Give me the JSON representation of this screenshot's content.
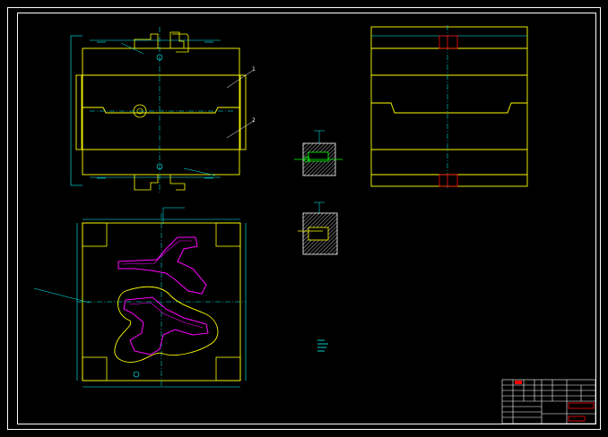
{
  "drawing": {
    "background": "#000000",
    "colors": {
      "border": "#ffffff",
      "outline": "#ffff00",
      "dimension": "#00ffff",
      "centerline": "#00ffff",
      "cavity": "#ff00ff",
      "section": "#00ff00",
      "hatch": "#ffffff",
      "highlight": "#ff0000"
    },
    "views": [
      {
        "name": "top-view",
        "kind": "plan"
      },
      {
        "name": "front-section-view",
        "kind": "section"
      },
      {
        "name": "plan-cavity-view",
        "kind": "cavity"
      },
      {
        "name": "detail-a",
        "kind": "detail"
      },
      {
        "name": "detail-b",
        "kind": "detail"
      }
    ],
    "balloons": [
      "1",
      "2"
    ]
  },
  "title_block": {
    "rows": [
      "",
      "",
      "",
      "",
      "",
      "",
      "",
      ""
    ],
    "stamp_color": "#ff0000"
  }
}
